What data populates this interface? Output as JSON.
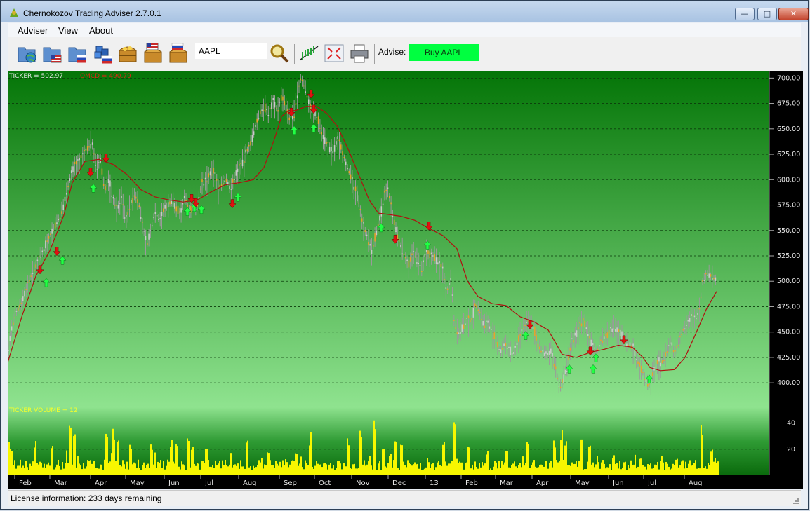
{
  "window": {
    "title": "Chernokozov Trading Adviser 2.7.0.1"
  },
  "menu": {
    "items": [
      "Adviser",
      "View",
      "About"
    ]
  },
  "toolbar": {
    "ticker_value": "AAPL",
    "advise_label": "Advise:",
    "advise_value": "Buy AAPL",
    "advise_color": "#00ff40",
    "icons": [
      "open-world-icon",
      "open-us-icon",
      "open-ru-icon",
      "cubes-ru-icon",
      "chest-world-icon",
      "chest-us-icon",
      "chest-ru-icon",
      "search-icon",
      "indicator-chart-icon",
      "fullscreen-icon",
      "print-icon"
    ]
  },
  "chart_data": {
    "type": "candlestick",
    "ticker_readout": "TICKER = 502.97",
    "omcd_readout": "OMCD = 490.79",
    "volume_readout": "TICKER VOLUME = 12",
    "price_ticks": [
      "700.00",
      "675.00",
      "650.00",
      "625.00",
      "600.00",
      "575.00",
      "550.00",
      "525.00",
      "500.00",
      "475.00",
      "450.00",
      "425.00",
      "400.00"
    ],
    "price_tick_values": [
      700,
      675,
      650,
      625,
      600,
      575,
      550,
      525,
      500,
      475,
      450,
      425,
      400
    ],
    "ylim": [
      387,
      703
    ],
    "volume_ticks": [
      "40",
      "20"
    ],
    "volume_tick_values": [
      40,
      20
    ],
    "volume_ylim": [
      0,
      50
    ],
    "months": [
      "Feb",
      "Mar",
      "Apr",
      "May",
      "Jun",
      "Jul",
      "Aug",
      "Sep",
      "Oct",
      "Nov",
      "Dec",
      "13",
      "Feb",
      "Mar",
      "Apr",
      "May",
      "Jun",
      "Jul",
      "Aug"
    ],
    "price_path": [
      [
        0,
        430
      ],
      [
        6,
        455
      ],
      [
        12,
        468
      ],
      [
        20,
        480
      ],
      [
        30,
        500
      ],
      [
        40,
        515
      ],
      [
        50,
        530
      ],
      [
        60,
        545
      ],
      [
        70,
        558
      ],
      [
        80,
        575
      ],
      [
        86,
        595
      ],
      [
        90,
        605
      ],
      [
        96,
        615
      ],
      [
        102,
        618
      ],
      [
        108,
        625
      ],
      [
        114,
        632
      ],
      [
        120,
        638
      ],
      [
        126,
        612
      ],
      [
        132,
        620
      ],
      [
        138,
        590
      ],
      [
        144,
        600
      ],
      [
        150,
        582
      ],
      [
        156,
        570
      ],
      [
        162,
        585
      ],
      [
        168,
        560
      ],
      [
        174,
        575
      ],
      [
        180,
        585
      ],
      [
        186,
        580
      ],
      [
        192,
        555
      ],
      [
        198,
        535
      ],
      [
        204,
        550
      ],
      [
        210,
        570
      ],
      [
        216,
        560
      ],
      [
        222,
        570
      ],
      [
        228,
        575
      ],
      [
        234,
        580
      ],
      [
        240,
        572
      ],
      [
        246,
        565
      ],
      [
        252,
        585
      ],
      [
        258,
        570
      ],
      [
        264,
        572
      ],
      [
        270,
        575
      ],
      [
        276,
        595
      ],
      [
        282,
        600
      ],
      [
        288,
        605
      ],
      [
        294,
        610
      ],
      [
        300,
        590
      ],
      [
        306,
        598
      ],
      [
        312,
        600
      ],
      [
        318,
        590
      ],
      [
        324,
        605
      ],
      [
        330,
        612
      ],
      [
        336,
        620
      ],
      [
        342,
        630
      ],
      [
        348,
        640
      ],
      [
        354,
        655
      ],
      [
        360,
        668
      ],
      [
        366,
        672
      ],
      [
        372,
        665
      ],
      [
        378,
        678
      ],
      [
        384,
        668
      ],
      [
        390,
        682
      ],
      [
        396,
        672
      ],
      [
        402,
        660
      ],
      [
        408,
        666
      ],
      [
        414,
        690
      ],
      [
        418,
        700
      ],
      [
        424,
        690
      ],
      [
        430,
        672
      ],
      [
        436,
        668
      ],
      [
        442,
        660
      ],
      [
        448,
        645
      ],
      [
        452,
        640
      ],
      [
        458,
        630
      ],
      [
        464,
        628
      ],
      [
        470,
        640
      ],
      [
        476,
        630
      ],
      [
        482,
        615
      ],
      [
        488,
        605
      ],
      [
        494,
        590
      ],
      [
        500,
        580
      ],
      [
        506,
        555
      ],
      [
        512,
        545
      ],
      [
        518,
        530
      ],
      [
        524,
        545
      ],
      [
        530,
        560
      ],
      [
        536,
        585
      ],
      [
        542,
        590
      ],
      [
        548,
        565
      ],
      [
        554,
        548
      ],
      [
        560,
        535
      ],
      [
        566,
        525
      ],
      [
        572,
        515
      ],
      [
        578,
        530
      ],
      [
        584,
        520
      ],
      [
        590,
        510
      ],
      [
        596,
        530
      ],
      [
        602,
        525
      ],
      [
        608,
        525
      ],
      [
        614,
        518
      ],
      [
        620,
        510
      ],
      [
        626,
        490
      ],
      [
        632,
        505
      ],
      [
        636,
        460
      ],
      [
        642,
        448
      ],
      [
        648,
        455
      ],
      [
        654,
        462
      ],
      [
        660,
        460
      ],
      [
        666,
        478
      ],
      [
        672,
        470
      ],
      [
        678,
        458
      ],
      [
        684,
        460
      ],
      [
        690,
        450
      ],
      [
        696,
        440
      ],
      [
        702,
        430
      ],
      [
        708,
        440
      ],
      [
        714,
        432
      ],
      [
        720,
        428
      ],
      [
        726,
        440
      ],
      [
        732,
        452
      ],
      [
        738,
        458
      ],
      [
        744,
        462
      ],
      [
        750,
        452
      ],
      [
        756,
        436
      ],
      [
        762,
        430
      ],
      [
        768,
        428
      ],
      [
        774,
        432
      ],
      [
        780,
        415
      ],
      [
        786,
        395
      ],
      [
        792,
        405
      ],
      [
        798,
        420
      ],
      [
        804,
        440
      ],
      [
        810,
        448
      ],
      [
        816,
        460
      ],
      [
        820,
        462
      ],
      [
        826,
        452
      ],
      [
        832,
        438
      ],
      [
        838,
        428
      ],
      [
        844,
        440
      ],
      [
        850,
        445
      ],
      [
        856,
        450
      ],
      [
        862,
        455
      ],
      [
        868,
        452
      ],
      [
        874,
        448
      ],
      [
        880,
        440
      ],
      [
        886,
        438
      ],
      [
        892,
        432
      ],
      [
        898,
        420
      ],
      [
        904,
        412
      ],
      [
        910,
        400
      ],
      [
        914,
        398
      ],
      [
        920,
        412
      ],
      [
        926,
        420
      ],
      [
        932,
        420
      ],
      [
        938,
        430
      ],
      [
        944,
        440
      ],
      [
        950,
        428
      ],
      [
        956,
        440
      ],
      [
        962,
        452
      ],
      [
        968,
        460
      ],
      [
        974,
        465
      ],
      [
        980,
        462
      ],
      [
        986,
        475
      ],
      [
        990,
        500
      ],
      [
        996,
        508
      ],
      [
        1002,
        505
      ],
      [
        1008,
        502
      ]
    ],
    "omcd_path": [
      [
        0,
        420
      ],
      [
        20,
        465
      ],
      [
        40,
        505
      ],
      [
        60,
        530
      ],
      [
        80,
        565
      ],
      [
        92,
        597
      ],
      [
        110,
        618
      ],
      [
        130,
        620
      ],
      [
        150,
        615
      ],
      [
        170,
        605
      ],
      [
        190,
        590
      ],
      [
        210,
        583
      ],
      [
        230,
        580
      ],
      [
        250,
        578
      ],
      [
        270,
        580
      ],
      [
        290,
        588
      ],
      [
        310,
        595
      ],
      [
        330,
        597
      ],
      [
        350,
        600
      ],
      [
        365,
        612
      ],
      [
        380,
        640
      ],
      [
        390,
        662
      ],
      [
        400,
        668
      ],
      [
        410,
        668
      ],
      [
        425,
        672
      ],
      [
        440,
        672
      ],
      [
        455,
        665
      ],
      [
        470,
        652
      ],
      [
        485,
        630
      ],
      [
        500,
        605
      ],
      [
        515,
        580
      ],
      [
        528,
        567
      ],
      [
        540,
        566
      ],
      [
        560,
        564
      ],
      [
        580,
        560
      ],
      [
        600,
        552
      ],
      [
        620,
        545
      ],
      [
        640,
        532
      ],
      [
        655,
        500
      ],
      [
        670,
        485
      ],
      [
        690,
        478
      ],
      [
        710,
        476
      ],
      [
        730,
        465
      ],
      [
        750,
        460
      ],
      [
        770,
        452
      ],
      [
        790,
        428
      ],
      [
        810,
        425
      ],
      [
        830,
        430
      ],
      [
        850,
        433
      ],
      [
        870,
        437
      ],
      [
        890,
        435
      ],
      [
        905,
        425
      ],
      [
        915,
        415
      ],
      [
        930,
        412
      ],
      [
        950,
        413
      ],
      [
        965,
        425
      ],
      [
        980,
        448
      ],
      [
        995,
        472
      ],
      [
        1010,
        490
      ]
    ],
    "up_signals": [
      [
        55,
        498
      ],
      [
        78,
        520
      ],
      [
        122,
        591
      ],
      [
        256,
        568
      ],
      [
        266,
        572
      ],
      [
        276,
        570
      ],
      [
        328,
        582
      ],
      [
        408,
        648
      ],
      [
        436,
        650
      ],
      [
        532,
        552
      ],
      [
        598,
        535
      ],
      [
        738,
        446
      ],
      [
        800,
        413
      ],
      [
        834,
        413
      ],
      [
        838,
        424
      ],
      [
        914,
        403
      ]
    ],
    "down_signals": [
      [
        46,
        512
      ],
      [
        70,
        530
      ],
      [
        118,
        608
      ],
      [
        140,
        622
      ],
      [
        262,
        582
      ],
      [
        268,
        578
      ],
      [
        320,
        577
      ],
      [
        404,
        667
      ],
      [
        432,
        685
      ],
      [
        436,
        670
      ],
      [
        552,
        542
      ],
      [
        600,
        555
      ],
      [
        744,
        458
      ],
      [
        830,
        432
      ],
      [
        878,
        443
      ]
    ],
    "volume_baseline": 4,
    "volume_peaks": [
      [
        0,
        28
      ],
      [
        4,
        20
      ],
      [
        38,
        24
      ],
      [
        62,
        22
      ],
      [
        88,
        42
      ],
      [
        94,
        30
      ],
      [
        140,
        28
      ],
      [
        150,
        33
      ],
      [
        156,
        32
      ],
      [
        174,
        20
      ],
      [
        204,
        22
      ],
      [
        232,
        24
      ],
      [
        240,
        22
      ],
      [
        256,
        26
      ],
      [
        262,
        22
      ],
      [
        282,
        20
      ],
      [
        340,
        26
      ],
      [
        370,
        18
      ],
      [
        410,
        20
      ],
      [
        430,
        24
      ],
      [
        484,
        28
      ],
      [
        502,
        32
      ],
      [
        522,
        40
      ],
      [
        534,
        24
      ],
      [
        552,
        30
      ],
      [
        560,
        24
      ],
      [
        620,
        24
      ],
      [
        636,
        48
      ],
      [
        656,
        26
      ],
      [
        682,
        18
      ],
      [
        710,
        18
      ],
      [
        740,
        24
      ],
      [
        778,
        26
      ],
      [
        788,
        32
      ],
      [
        794,
        24
      ],
      [
        816,
        28
      ],
      [
        828,
        22
      ],
      [
        862,
        16
      ],
      [
        900,
        14
      ],
      [
        952,
        14
      ],
      [
        988,
        30
      ],
      [
        1002,
        22
      ]
    ]
  },
  "status": {
    "text": "License information: 233 days remaining"
  }
}
